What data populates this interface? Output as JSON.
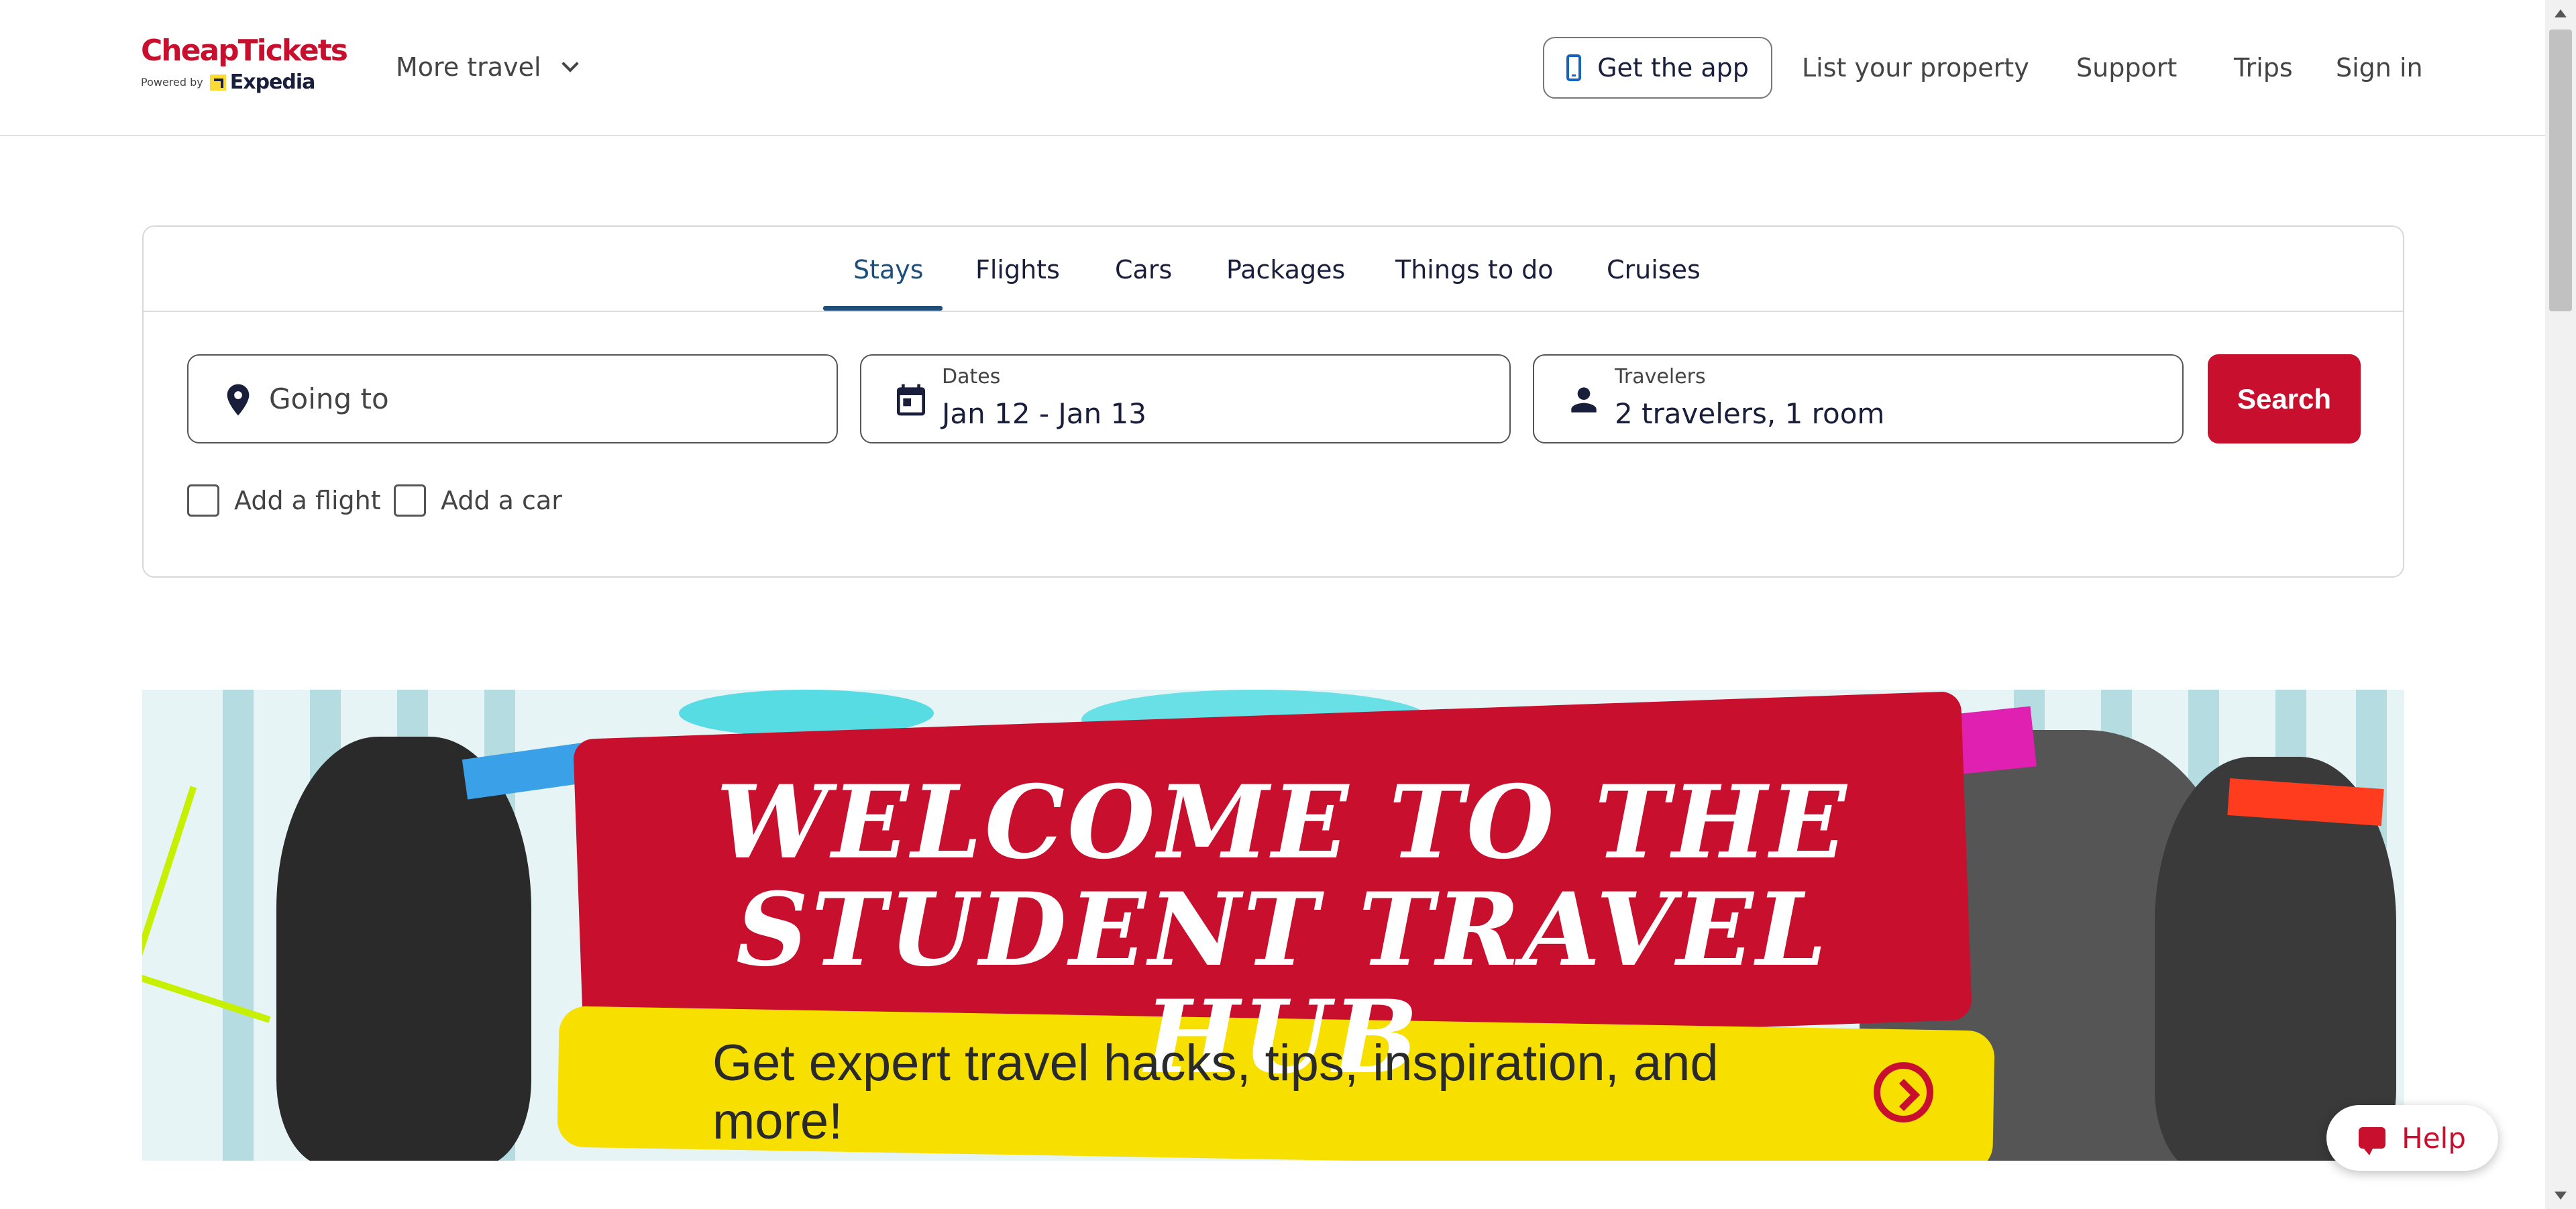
{
  "header": {
    "logo_main": "CheapTickets",
    "logo_powered": "Powered by",
    "logo_expedia": "Expedia",
    "more_travel": "More travel",
    "get_app": "Get the app",
    "list_property": "List your property",
    "support": "Support",
    "trips": "Trips",
    "sign_in": "Sign in"
  },
  "search": {
    "tabs": [
      {
        "label": "Stays",
        "active": true
      },
      {
        "label": "Flights",
        "active": false
      },
      {
        "label": "Cars",
        "active": false
      },
      {
        "label": "Packages",
        "active": false
      },
      {
        "label": "Things to do",
        "active": false
      },
      {
        "label": "Cruises",
        "active": false
      }
    ],
    "going_to_placeholder": "Going to",
    "dates_label": "Dates",
    "dates_value": "Jan 12 - Jan 13",
    "travelers_label": "Travelers",
    "travelers_value": "2 travelers, 1 room",
    "search_button": "Search",
    "add_flight": "Add a flight",
    "add_car": "Add a car"
  },
  "banner": {
    "headline_line1": "WELCOME TO THE",
    "headline_line2": "STUDENT TRAVEL HUB",
    "subline": "Get expert travel hacks, tips, inspiration, and more!"
  },
  "help": {
    "label": "Help"
  },
  "colors": {
    "brand_red": "#c8102e",
    "active_tab": "#1f4e79",
    "banner_yellow": "#f7e000",
    "text_dark": "#191e3b"
  }
}
